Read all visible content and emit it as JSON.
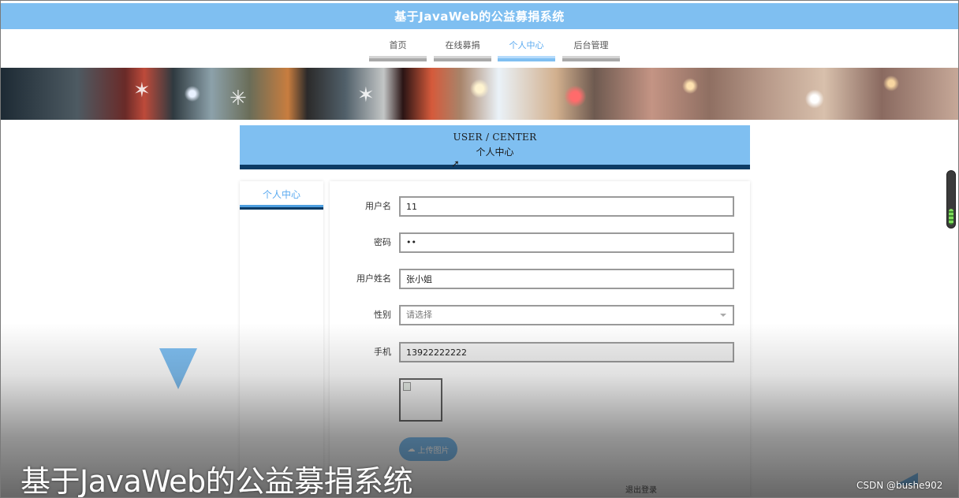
{
  "app": {
    "title": "基于JavaWeb的公益募捐系统"
  },
  "nav": {
    "items": [
      {
        "label": "首页",
        "active": false
      },
      {
        "label": "在线募捐",
        "active": false
      },
      {
        "label": "个人中心",
        "active": true
      },
      {
        "label": "后台管理",
        "active": false
      }
    ]
  },
  "user_center": {
    "title_en": "USER / CENTER",
    "title_cn": "个人中心"
  },
  "sidebar": {
    "items": [
      {
        "label": "个人中心"
      }
    ]
  },
  "form": {
    "username": {
      "label": "用户名",
      "value": "11"
    },
    "password": {
      "label": "密码",
      "value": "••"
    },
    "real_name": {
      "label": "用户姓名",
      "value": "张小姐"
    },
    "gender": {
      "label": "性别",
      "value": "请选择"
    },
    "phone": {
      "label": "手机",
      "value": "13922222222"
    },
    "upload_label": "上传图片",
    "logout_label": "退出登录"
  },
  "video_caption": "基于JavaWeb的公益募捐系统",
  "watermark": "CSDN @bushe902",
  "colors": {
    "accent": "#7fbff1",
    "dark_accent": "#0d3c66"
  },
  "icons": {
    "upload": "cloud-upload-icon",
    "select": "chevron-down-icon",
    "cursor": "mouse-cursor-icon"
  }
}
